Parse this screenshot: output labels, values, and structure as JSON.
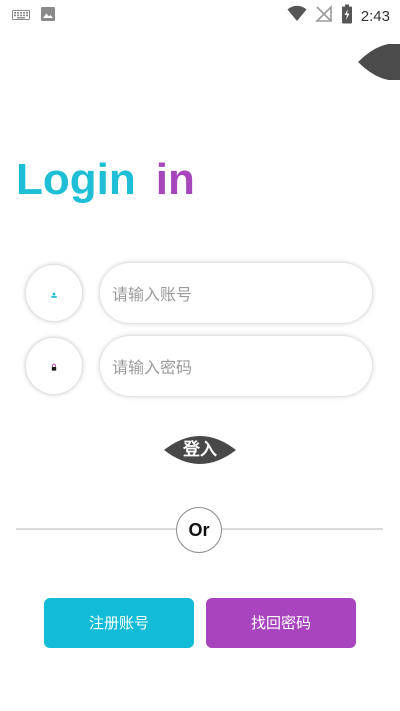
{
  "status_bar": {
    "time": "2:43",
    "left_icons": [
      "keyboard-icon",
      "image-icon"
    ],
    "right_icons": [
      "wifi-icon",
      "signal-off-icon",
      "battery-charging-icon"
    ]
  },
  "title": {
    "part1": "Login",
    "part2": "in",
    "color_part1": "#1ebed7",
    "color_part2": "#a745bd"
  },
  "form": {
    "account": {
      "placeholder": "请输入账号",
      "value": "",
      "icon": "user-icon"
    },
    "password": {
      "placeholder": "请输入密码",
      "value": "",
      "icon": "lock-icon"
    }
  },
  "login_button": {
    "label": "登入",
    "color": "#484848"
  },
  "divider": {
    "label": "Or"
  },
  "actions": {
    "register_label": "注册账号",
    "register_color": "#12bcd7",
    "find_password_label": "找回密码",
    "find_password_color": "#a845be"
  }
}
